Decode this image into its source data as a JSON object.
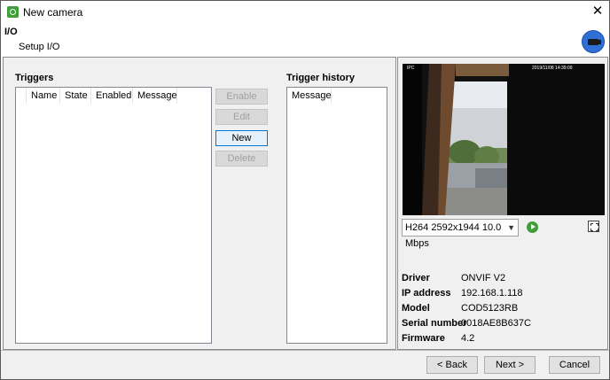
{
  "window": {
    "title": "New camera",
    "close_glyph": "✕"
  },
  "header": {
    "title": "I/O",
    "subtitle": "Setup I/O",
    "badge_icon": "camera-icon"
  },
  "triggers": {
    "label": "Triggers",
    "columns": [
      "Name",
      "State",
      "Enabled",
      "Message"
    ],
    "rows": []
  },
  "actions": {
    "enable": "Enable",
    "edit": "Edit",
    "new": "New",
    "delete": "Delete"
  },
  "history": {
    "label": "Trigger history",
    "columns": [
      "Message"
    ],
    "rows": []
  },
  "preview": {
    "stream_selected": "H264 2592x1944 10.0 Mbps",
    "overlay_left": "IPC",
    "overlay_right": "2019/11/08 14:39:09",
    "play_icon": "play-icon",
    "fullscreen_icon": "fullscreen-icon"
  },
  "camera_info": {
    "driver_label": "Driver",
    "driver": "ONVIF V2",
    "ip_label": "IP address",
    "ip": "192.168.1.118",
    "model_label": "Model",
    "model": "COD5123RB",
    "serial_label": "Serial number",
    "serial": "0018AE8B637C",
    "firmware_label": "Firmware",
    "firmware": "4.2"
  },
  "footer": {
    "back": "< Back",
    "next": "Next >",
    "cancel": "Cancel"
  },
  "colors": {
    "accent_green": "#3f9e3a",
    "badge_blue": "#2f6fd6",
    "default_button_border": "#0078d7"
  }
}
